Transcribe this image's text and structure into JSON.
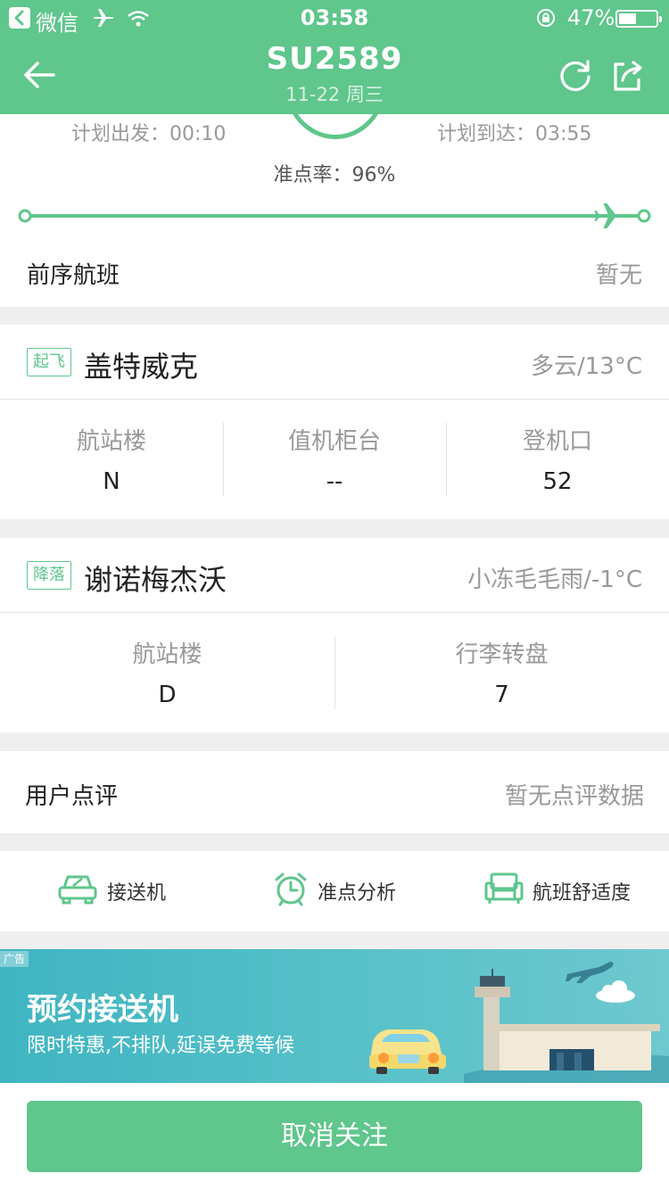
{
  "status_bar": {
    "app_name": "微信",
    "time": "03:58",
    "battery_percent": "47%",
    "battery_level": 0.47
  },
  "nav": {
    "flight_no": "SU2589",
    "date_line": "11-22  周三"
  },
  "schedule": {
    "planned_departure": "计划出发：00:10",
    "planned_arrival": "计划到达：03:55",
    "ontime_rate": "准点率：96%",
    "progress": 0.97
  },
  "previous_flight": {
    "label": "前序航班",
    "value": "暂无"
  },
  "departure": {
    "tag": "起飞",
    "city": "盖特威克",
    "weather": "多云/13°C",
    "columns": [
      {
        "label": "航站楼",
        "value": "N"
      },
      {
        "label": "值机柜台",
        "value": "--"
      },
      {
        "label": "登机口",
        "value": "52"
      }
    ]
  },
  "arrival": {
    "tag": "降落",
    "city": "谢诺梅杰沃",
    "weather": "小冻毛毛雨/-1°C",
    "columns": [
      {
        "label": "航站楼",
        "value": "D"
      },
      {
        "label": "行李转盘",
        "value": "7"
      }
    ]
  },
  "review": {
    "label": "用户点评",
    "value": "暂无点评数据"
  },
  "tools": [
    {
      "label": "接送机",
      "icon": "car-icon"
    },
    {
      "label": "准点分析",
      "icon": "alarm-clock-icon"
    },
    {
      "label": "航班舒适度",
      "icon": "seat-icon"
    }
  ],
  "ad": {
    "badge": "广告",
    "title": "预约接送机",
    "subtitle": "限时特惠,不排队,延误免费等候"
  },
  "bottom_button": {
    "label": "取消关注"
  },
  "colors": {
    "brand_green": "#5fc68c",
    "ad_teal": "#4dbcc5"
  }
}
